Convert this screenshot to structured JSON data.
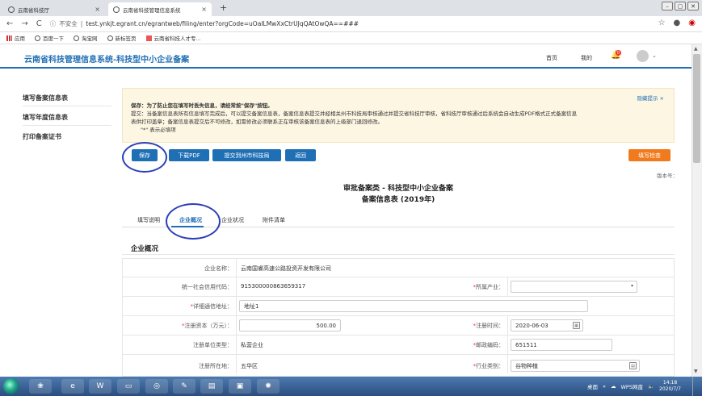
{
  "browser": {
    "tabs": [
      {
        "label": "云南省科技厅",
        "active": false
      },
      {
        "label": "云南省科技管理信息系统",
        "active": true
      }
    ],
    "url_prefix": "不安全",
    "url": "test.ynkjt.egrant.cn/egrantweb/filing/enter?orgCode=uOaILMwXxCtrUJqQAtOwQA==###",
    "bookmarks": [
      "应用",
      "百度一下",
      "淘宝网",
      "新标签页",
      "云南省科技人才专..."
    ]
  },
  "site": {
    "title": "云南省科技管理信息系统-科技型中小企业备案",
    "nav": [
      "首页",
      "我的"
    ],
    "notification_count": "0"
  },
  "sidebar": {
    "items": [
      "填写备案信息表",
      "填写年度信息表",
      "打印备案证书"
    ]
  },
  "notice": {
    "hide_label": "隐藏提示 ×",
    "line1": "保存：为了防止您在填写时丢失信息，请经常按\"保存\"按钮。",
    "line2": "提交：当备案信息表所有信息填写完成后，可以提交备案信息表，备案信息表提交并经相关州市科技局审核通过并提交省科技厅审核，省科技厅审核通过后系统会自动生成PDF格式正式备案信息",
    "line3": "表供打印盖章；备案信息表提交后不可修改，如需修改必须联系正在审核该备案信息表的上级部门退回修改。",
    "line4": "\"*\" 表示必填项"
  },
  "actions": {
    "save": "保存",
    "download": "下载PDF",
    "submit": "提交到州市科技局",
    "back": "返回",
    "check": "填写检查"
  },
  "form": {
    "version_label": "版本号：",
    "title1": "审批备案类 - 科技型中小企业备案",
    "title2": "备案信息表 (2019年)",
    "tabs": [
      "填写说明",
      "企业概况",
      "企业状况",
      "附件清单"
    ],
    "section": "企业概况",
    "fields": {
      "company_name_label": "企业名称：",
      "company_name": "云南国睿高速公路投资开发有限公司",
      "credit_code_label": "统一社会信用代码：",
      "credit_code": "915300000863659317",
      "industry_label": "所属产业：",
      "industry": "",
      "address_label": "详细通信地址：",
      "address": "地址1",
      "capital_label": "注册资本（万元）：",
      "capital": "500.00",
      "reg_date_label": "注册时间：",
      "reg_date": "2020-06-03",
      "unit_type_label": "注册单位类型：",
      "unit_type": "私营企业",
      "postcode_label": "邮政编码：",
      "postcode": "651511",
      "location_label": "注册所在地：",
      "location": "五华区",
      "category_label": "行业类别：",
      "category": "谷物种植"
    }
  },
  "taskbar": {
    "tray_text": "桌面",
    "wps_label": "WPS网盘",
    "time": "14:18",
    "date": "2020/7/7"
  }
}
